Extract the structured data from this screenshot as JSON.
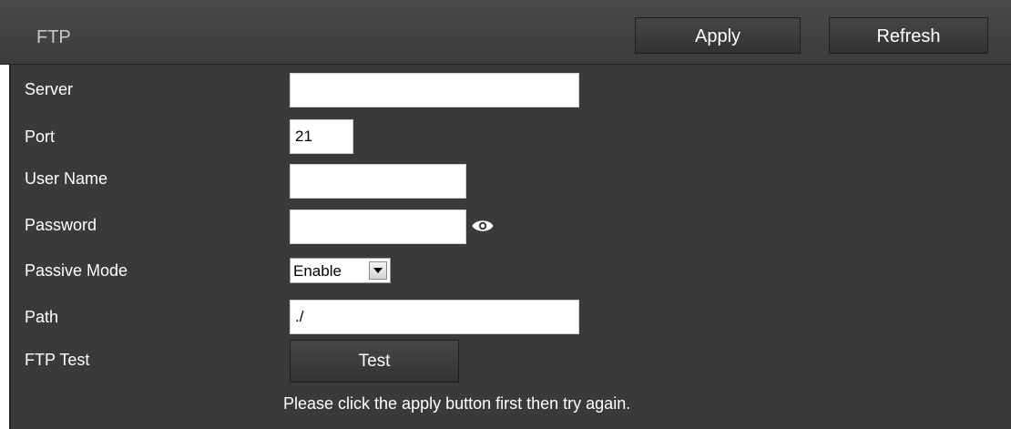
{
  "header": {
    "title": "FTP",
    "apply_label": "Apply",
    "refresh_label": "Refresh"
  },
  "form": {
    "server": {
      "label": "Server",
      "value": ""
    },
    "port": {
      "label": "Port",
      "value": "21"
    },
    "user_name": {
      "label": "User Name",
      "value": ""
    },
    "password": {
      "label": "Password",
      "value": "",
      "toggle_icon": "eye-icon"
    },
    "passive_mode": {
      "label": "Passive Mode",
      "selected": "Enable"
    },
    "path": {
      "label": "Path",
      "value": "./"
    },
    "ftp_test": {
      "label": "FTP Test",
      "button_label": "Test"
    }
  },
  "message": "Please click the apply button first then try again.",
  "colors": {
    "header_bg": "#434343",
    "body_bg": "#3a3a3a",
    "text": "#ffffff",
    "title_text": "#c8c8c8"
  }
}
